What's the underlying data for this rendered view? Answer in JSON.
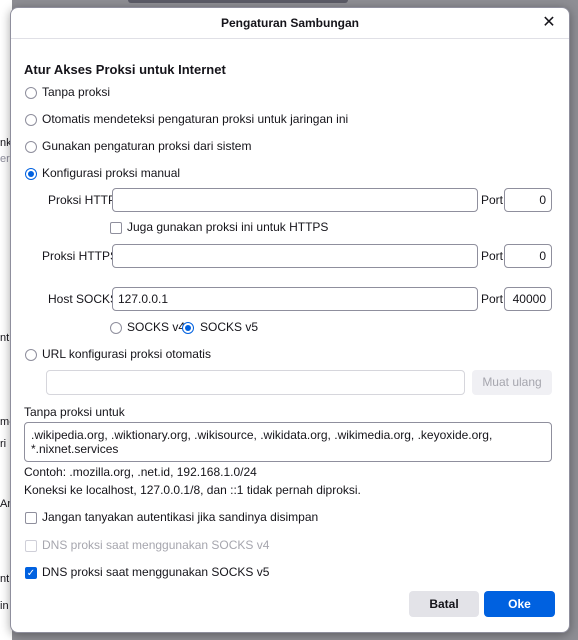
{
  "background": {
    "fragments": [
      "nk",
      "era",
      "nt",
      "m-",
      "ri",
      "An",
      "nt",
      "in"
    ]
  },
  "dialog": {
    "title": "Pengaturan Sambungan",
    "close_glyph": "✕",
    "heading": "Atur Akses Proksi untuk Internet",
    "radios": {
      "no_proxy": "Tanpa proksi",
      "auto_detect": "Otomatis mendeteksi pengaturan proksi untuk jaringan ini",
      "system": "Gunakan pengaturan proksi dari sistem",
      "manual": "Konfigurasi proksi manual",
      "pac": "URL konfigurasi proksi otomatis"
    },
    "selected_mode": "manual",
    "http": {
      "label": "Proksi HTTP",
      "value": "",
      "port_label": "Port",
      "port_value": "0"
    },
    "also_https": {
      "label": "Juga gunakan proksi ini untuk HTTPS",
      "checked": false
    },
    "https": {
      "label": "Proksi HTTPS",
      "value": "",
      "port_label": "Port",
      "port_value": "0"
    },
    "socks": {
      "label": "Host SOCKS",
      "value": "127.0.0.1",
      "port_label": "Port",
      "port_value": "40000"
    },
    "socks_v4": "SOCKS v4",
    "socks_v5": "SOCKS v5",
    "socks_version": "v5",
    "pac_url": "",
    "reload_button": "Muat ulang",
    "no_proxy_for": {
      "label": "Tanpa proksi untuk",
      "value": ".wikipedia.org, .wiktionary.org, .wikisource, .wikidata.org, .wikimedia.org, .keyoxide.org,\n*.nixnet.services"
    },
    "example": "Contoh: .mozilla.org, .net.id, 192.168.1.0/24",
    "localhost_note": "Koneksi ke localhost, 127.0.0.1/8, dan ::1 tidak pernah diproksi.",
    "no_auth_prompt": {
      "label": "Jangan tanyakan autentikasi jika sandinya disimpan",
      "checked": false
    },
    "dns_v4": {
      "label": "DNS proksi saat menggunakan SOCKS v4",
      "checked": false,
      "disabled": true
    },
    "dns_v5": {
      "label": "DNS proksi saat menggunakan SOCKS v5",
      "checked": true
    },
    "cancel_button": "Batal",
    "ok_button": "Oke"
  },
  "colors": {
    "accent": "#0061e0",
    "text": "#15141a",
    "border": "#8f8f9d"
  }
}
